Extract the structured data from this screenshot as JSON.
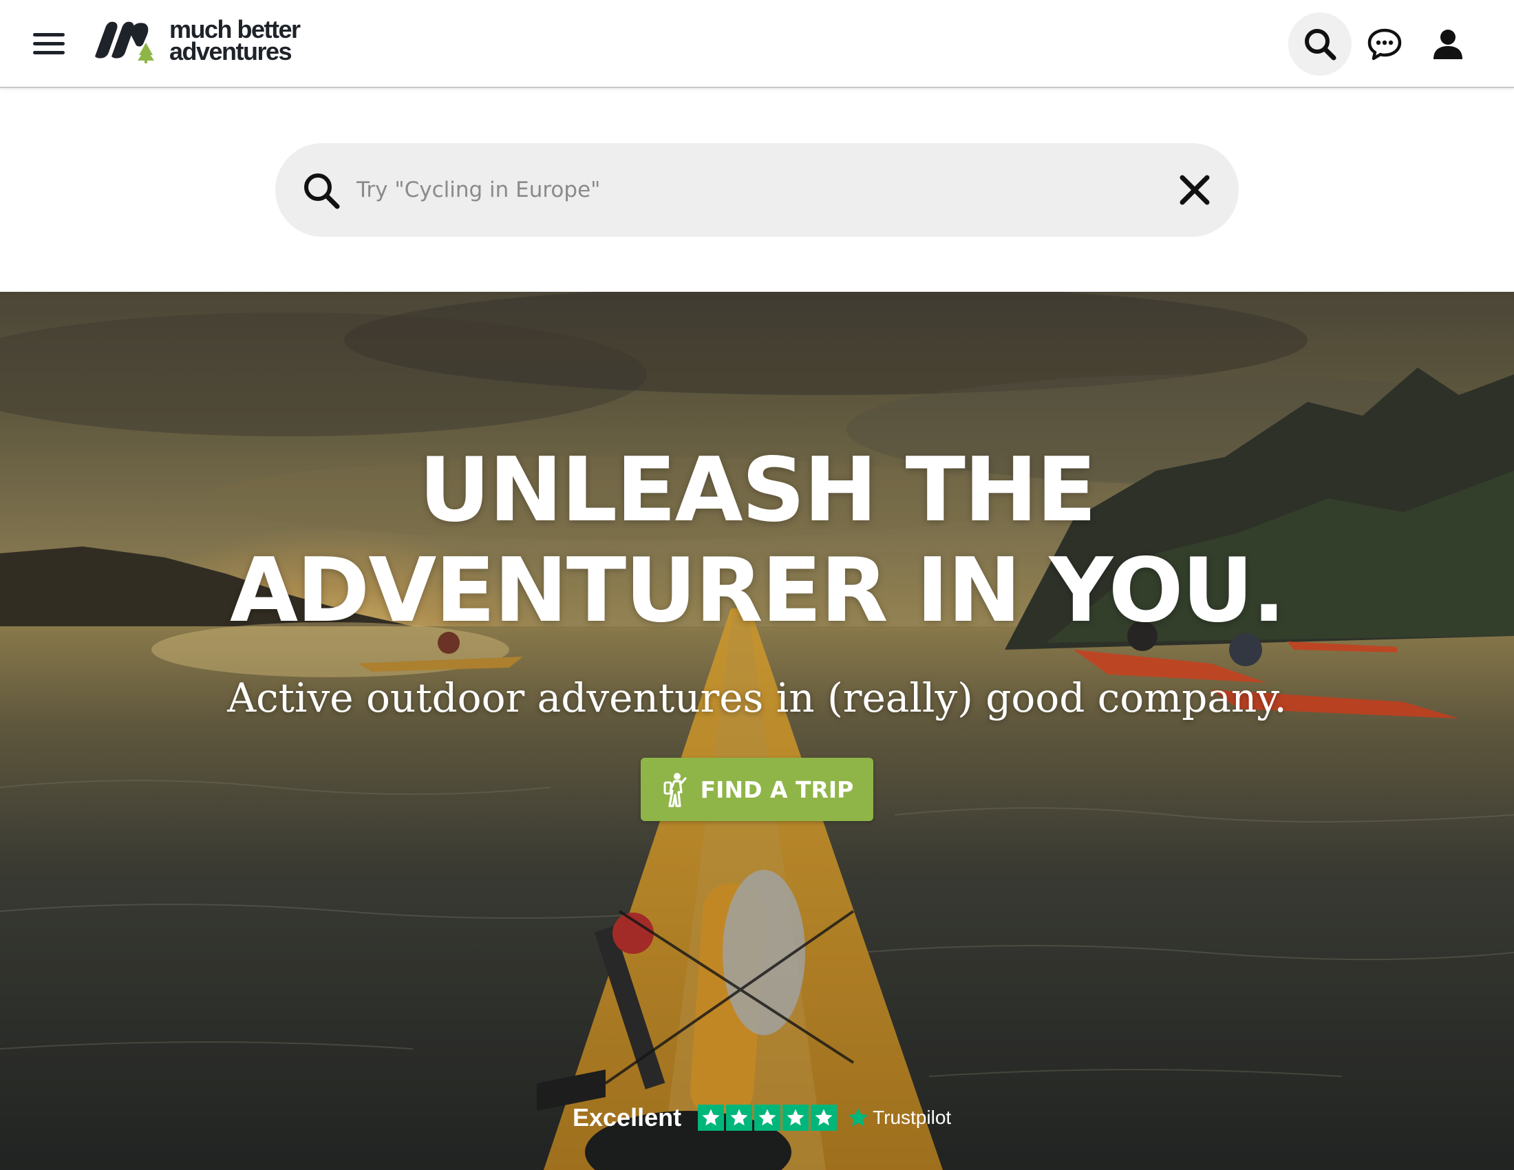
{
  "brand": {
    "name_line1": "much better",
    "name_line2": "adventures",
    "colors": {
      "ink": "#1e2229",
      "tree": "#8fb548"
    }
  },
  "header": {
    "icons": [
      "menu-icon",
      "search-icon",
      "chat-icon",
      "user-icon"
    ]
  },
  "search": {
    "placeholder": "Try \"Cycling in Europe\"",
    "value": ""
  },
  "hero": {
    "title_line1": "UNLEASH THE",
    "title_line2": "ADVENTURER IN YOU.",
    "subtitle": "Active outdoor adventures in (really) good company.",
    "cta_label": "FIND A TRIP",
    "cta_color": "#8fb548"
  },
  "trustpilot": {
    "rating_label": "Excellent",
    "stars": 5,
    "brand": "Trustpilot",
    "star_color": "#00b67a"
  }
}
